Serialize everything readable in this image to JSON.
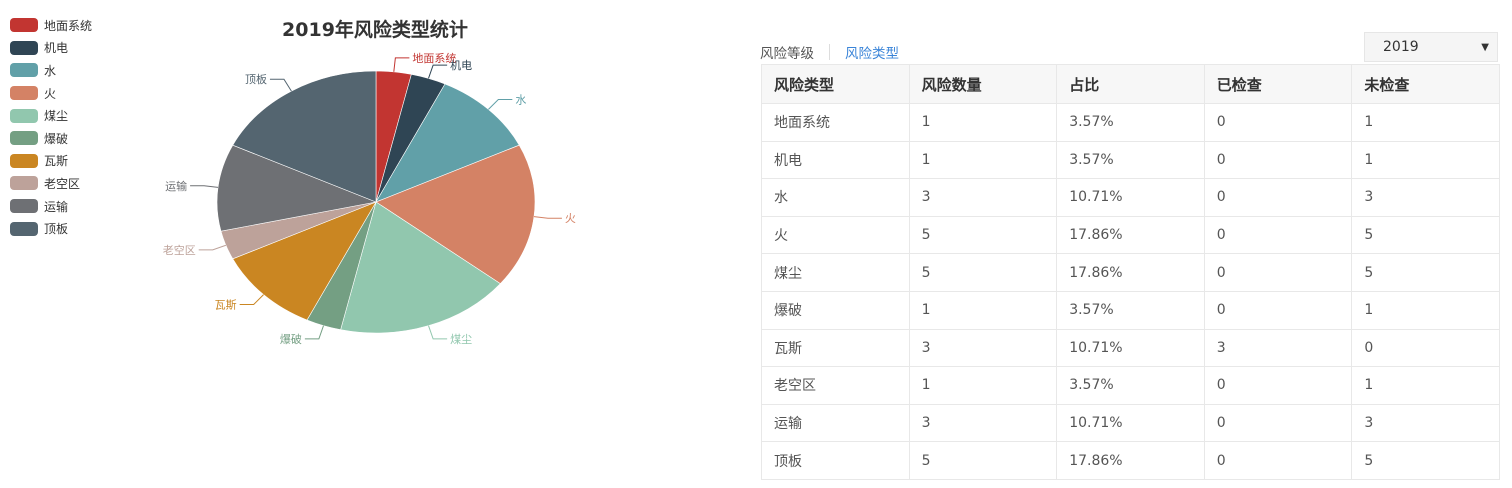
{
  "chart_data": {
    "type": "pie",
    "title": "2019年风险类型统计",
    "categories": [
      "地面系统",
      "机电",
      "水",
      "火",
      "煤尘",
      "爆破",
      "瓦斯",
      "老空区",
      "运输",
      "顶板"
    ],
    "values": [
      1,
      1,
      3,
      5,
      5,
      1,
      3,
      1,
      3,
      5
    ],
    "colors": [
      "#c23531",
      "#2f4554",
      "#61a0a8",
      "#d48265",
      "#91c7ae",
      "#749f83",
      "#ca8622",
      "#bda29a",
      "#6e7074",
      "#546570"
    ],
    "legend_position": "left"
  },
  "tabs": [
    {
      "label": "风险等级",
      "active": false
    },
    {
      "label": "风险类型",
      "active": true
    }
  ],
  "year_select": {
    "value": "2019",
    "icon": "caret-down-icon"
  },
  "table": {
    "headers": [
      "风险类型",
      "风险数量",
      "占比",
      "已检查",
      "未检查"
    ],
    "rows": [
      [
        "地面系统",
        "1",
        "3.57%",
        "0",
        "1"
      ],
      [
        "机电",
        "1",
        "3.57%",
        "0",
        "1"
      ],
      [
        "水",
        "3",
        "10.71%",
        "0",
        "3"
      ],
      [
        "火",
        "5",
        "17.86%",
        "0",
        "5"
      ],
      [
        "煤尘",
        "5",
        "17.86%",
        "0",
        "5"
      ],
      [
        "爆破",
        "1",
        "3.57%",
        "0",
        "1"
      ],
      [
        "瓦斯",
        "3",
        "10.71%",
        "3",
        "0"
      ],
      [
        "老空区",
        "1",
        "3.57%",
        "0",
        "1"
      ],
      [
        "运输",
        "3",
        "10.71%",
        "0",
        "3"
      ],
      [
        "顶板",
        "5",
        "17.86%",
        "0",
        "5"
      ]
    ]
  }
}
